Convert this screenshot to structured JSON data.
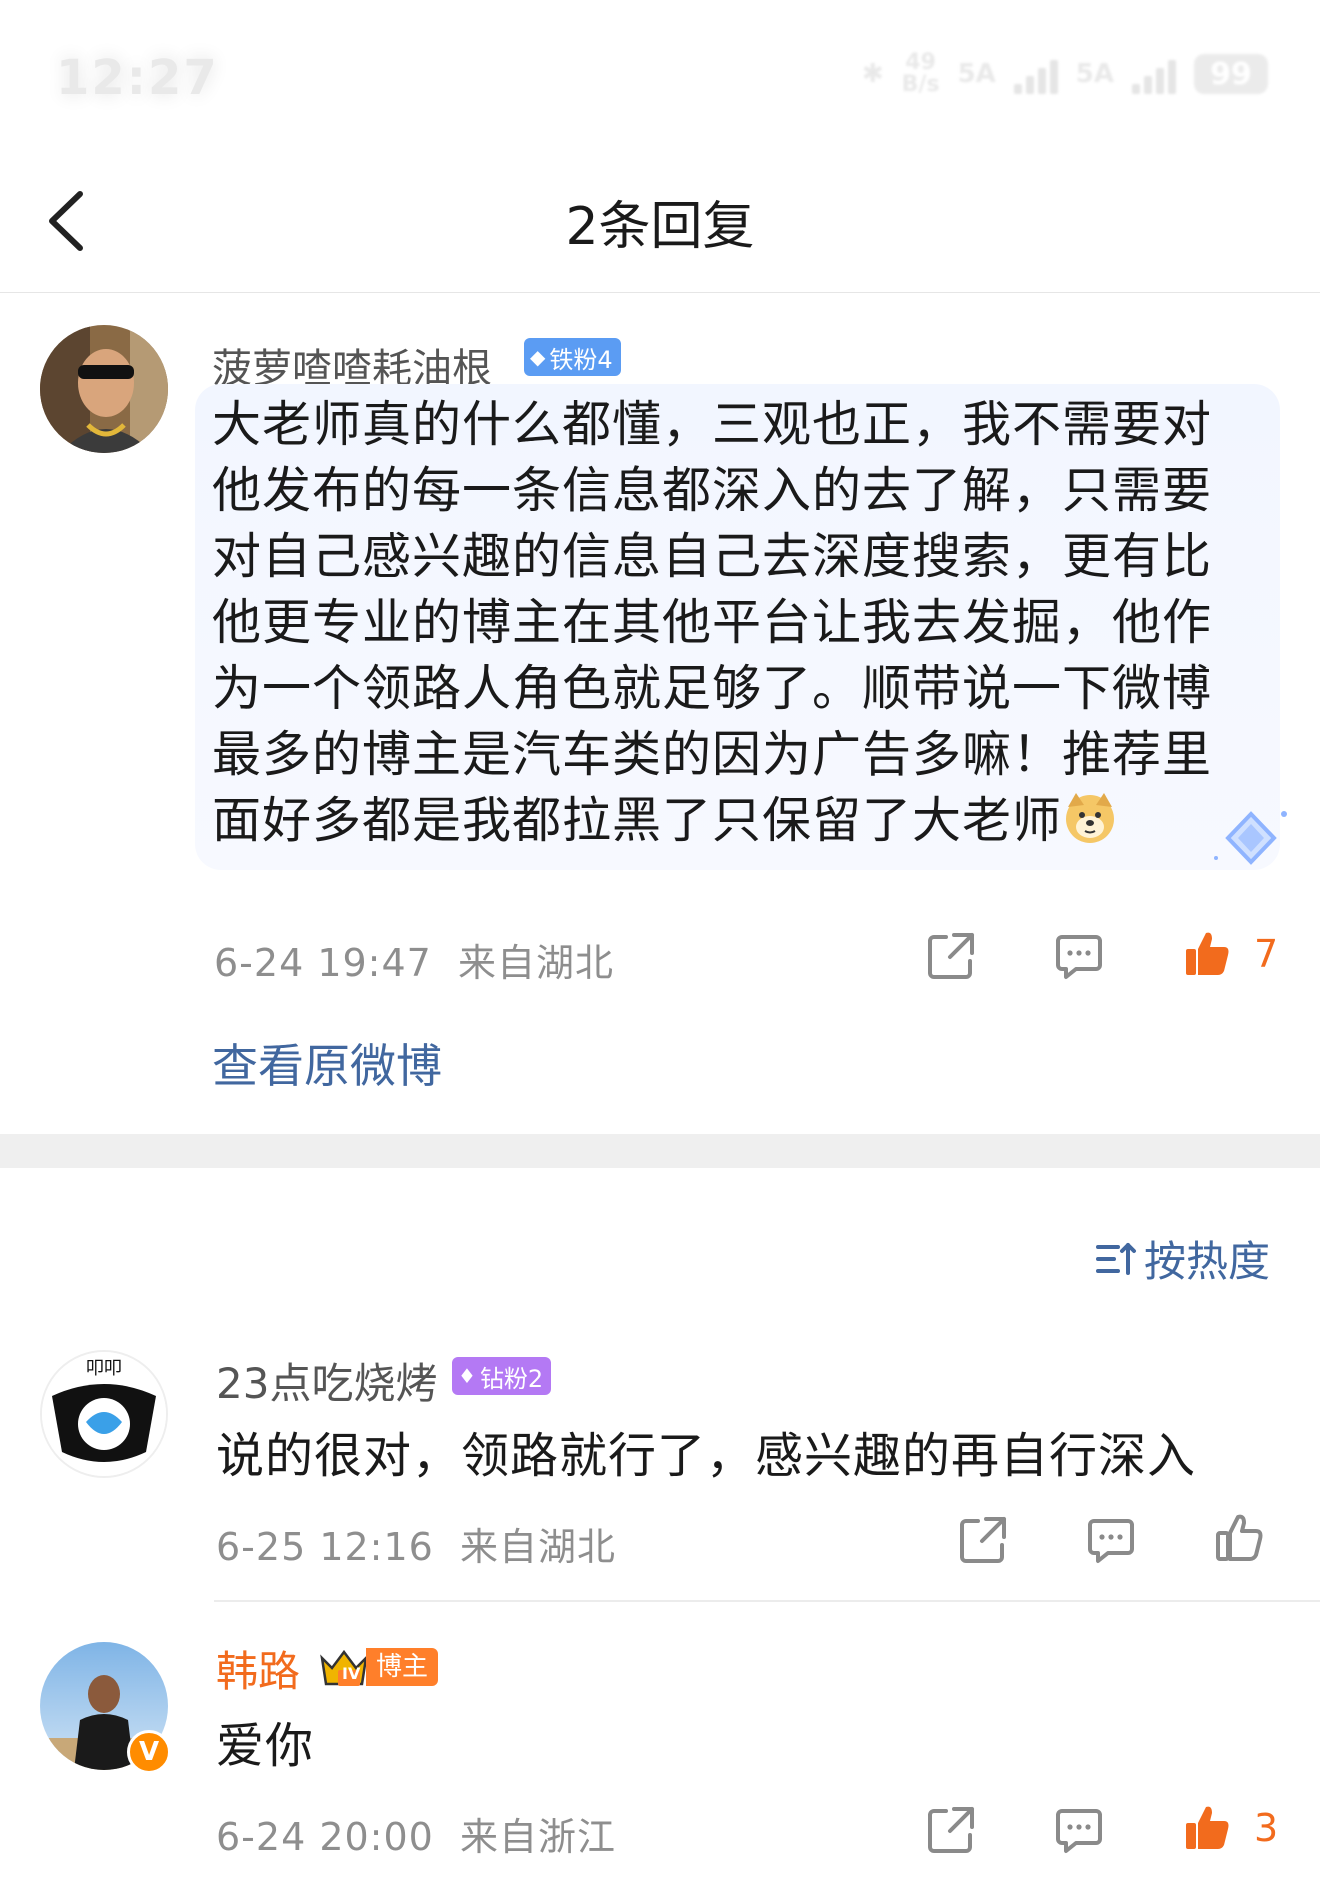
{
  "status_bar": {
    "time": "12:27",
    "net_speed_top": "49",
    "net_speed_bottom": "B/s",
    "sim1": "5A",
    "sim2": "5A",
    "battery": "99"
  },
  "nav": {
    "title": "2条回复"
  },
  "main_comment": {
    "username": "菠萝喳喳耗油根",
    "badge": "铁粉4",
    "text": "大老师真的什么都懂，三观也正，我不需要对他发布的每一条信息都深入的去了解，只需要对自己感兴趣的信息自己去深度搜索，更有比他更专业的博主在其他平台让我去发掘，他作为一个领路人角色就足够了。顺带说一下微博最多的博主是汽车类的因为广告多嘛！推荐里面好多都是我都拉黑了只保留了大老师",
    "time": "6-24 19:47",
    "location": "来自湖北",
    "likes": "7",
    "view_original": "查看原微博"
  },
  "sort": {
    "label": "按热度"
  },
  "replies": [
    {
      "username": "23点吃烧烤",
      "badge": "钻粉2",
      "text": "说的很对，领路就行了，感兴趣的再自行深入",
      "time": "6-25 12:16",
      "location": "来自湖北",
      "likes": ""
    },
    {
      "username": "韩路",
      "badge": "博主",
      "badge_level": "IV",
      "text": "爱你",
      "time": "6-24 20:00",
      "location": "来自浙江",
      "likes": "3"
    }
  ],
  "colors": {
    "link_blue": "#41679f",
    "like_orange": "#f26b1d",
    "blogger_orange": "#ff7f2a",
    "iron_fan_blue": "#5b9cf3",
    "diamond_fan_purple": "#b479f4"
  }
}
